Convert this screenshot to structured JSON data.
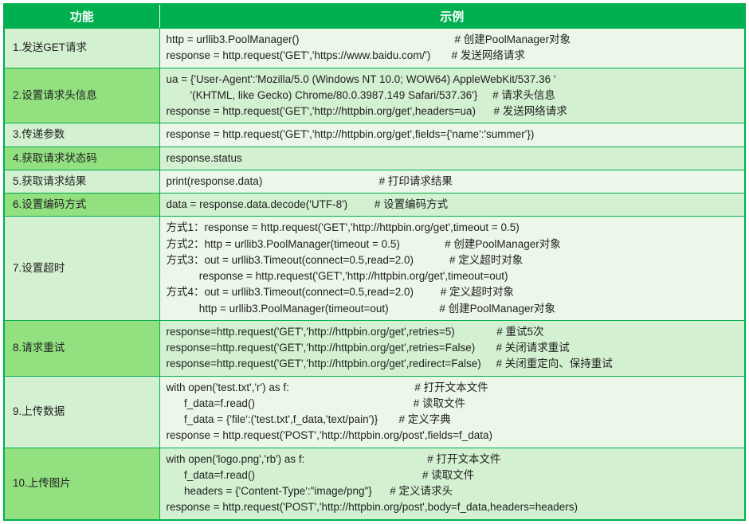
{
  "headers": {
    "func": "功能",
    "example": "示例"
  },
  "rows": [
    {
      "func": "1.发送GET请求",
      "example": "http = urllib3.PoolManager()                                                    # 创建PoolManager对象\nresponse = http.request('GET','https://www.baidu.com/')       # 发送网络请求"
    },
    {
      "func": "2.设置请求头信息",
      "example": "ua = {'User-Agent':'Mozilla/5.0 (Windows NT 10.0; WOW64) AppleWebKit/537.36 '\n        '(KHTML, like Gecko) Chrome/80.0.3987.149 Safari/537.36'}     # 请求头信息\nresponse = http.request('GET','http://httpbin.org/get',headers=ua)      # 发送网络请求"
    },
    {
      "func": "3.传递参数",
      "example": "response = http.request('GET','http://httpbin.org/get',fields={'name':'summer'})"
    },
    {
      "func": "4.获取请求状态码",
      "example": "response.status"
    },
    {
      "func": "5.获取请求结果",
      "example": "print(response.data)                                       # 打印请求结果"
    },
    {
      "func": "6.设置编码方式",
      "example": "data = response.data.decode('UTF-8')         # 设置编码方式"
    },
    {
      "func": "7.设置超时",
      "example": "方式1：response = http.request('GET','http://httpbin.org/get',timeout = 0.5)\n方式2：http = urllib3.PoolManager(timeout = 0.5)               # 创建PoolManager对象\n方式3：out = urllib3.Timeout(connect=0.5,read=2.0)            # 定义超时对象\n           response = http.request('GET','http://httpbin.org/get',timeout=out)\n方式4：out = urllib3.Timeout(connect=0.5,read=2.0)         # 定义超时对象\n           http = urllib3.PoolManager(timeout=out)                 # 创建PoolManager对象"
    },
    {
      "func": "8.请求重试",
      "example": "response=http.request('GET','http://httpbin.org/get',retries=5)              # 重试5次\nresponse=http.request('GET','http://httpbin.org/get',retries=False)       # 关闭请求重试\nresponse=http.request('GET','http://httpbin.org/get',redirect=False)     # 关闭重定向、保持重试"
    },
    {
      "func": "9.上传数据",
      "example": "with open('test.txt','r') as f:                                          # 打开文本文件\n      f_data=f.read()                                                     # 读取文件\n      f_data = {'file':('test.txt',f_data,'text/pain')}       # 定义字典\nresponse = http.request('POST','http://httpbin.org/post',fields=f_data)"
    },
    {
      "func": "10.上传图片",
      "example": "with open('logo.png','rb') as f:                                         # 打开文本文件\n      f_data=f.read()                                                        # 读取文件\n      headers = {'Content-Type':\"image/png\"}      # 定义请求头\nresponse = http.request('POST','http://httpbin.org/post',body=f_data,headers=headers)"
    }
  ]
}
